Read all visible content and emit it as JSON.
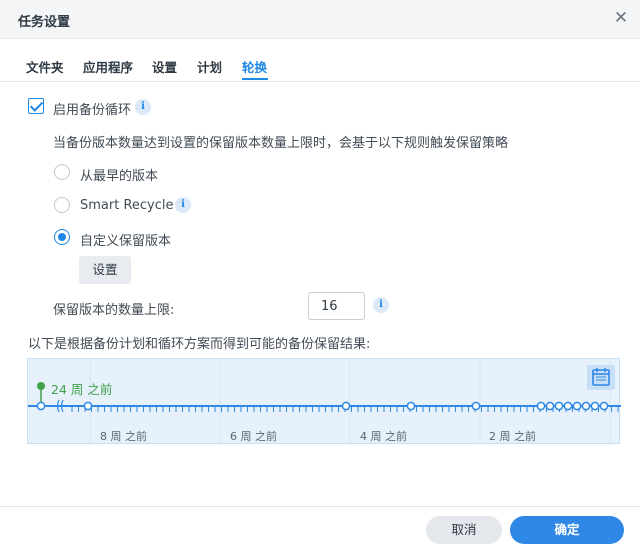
{
  "window": {
    "title": "任务设置"
  },
  "tabs": [
    {
      "label": "文件夹"
    },
    {
      "label": "应用程序"
    },
    {
      "label": "设置"
    },
    {
      "label": "计划"
    },
    {
      "label": "轮换"
    }
  ],
  "rotation": {
    "enable_label": "启用备份循环",
    "enabled": true,
    "description": "当备份版本数量达到设置的保留版本数量上限时，会基于以下规则触发保留策略",
    "options": [
      {
        "label": "从最早的版本",
        "selected": false
      },
      {
        "label": "Smart Recycle",
        "selected": false
      },
      {
        "label": "自定义保留版本",
        "selected": true
      }
    ],
    "setup_button": "设置",
    "max_versions_label": "保留版本的数量上限:",
    "max_versions_value": "16",
    "result_label": "以下是根据备份计划和循环方案而得到可能的备份保留结果:"
  },
  "timeline": {
    "start_label": "24 周 之前",
    "week_labels": [
      "8 周 之前",
      "6 周 之前",
      "4 周 之前",
      "2 周 之前"
    ],
    "calendar_icon": "calendar-icon",
    "line_color": "#2f88e5"
  },
  "footer": {
    "cancel": "取消",
    "ok": "确定"
  }
}
